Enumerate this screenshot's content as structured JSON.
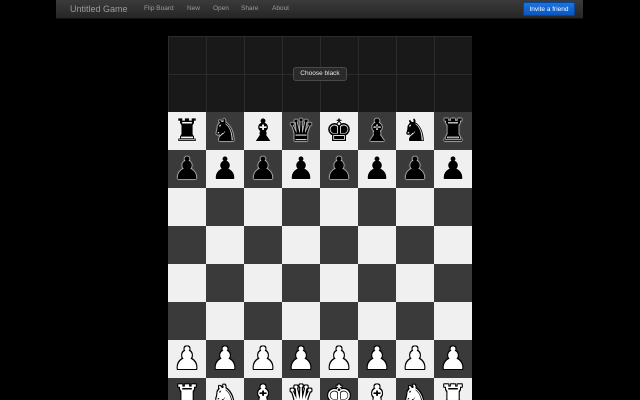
{
  "navbar": {
    "title": "Untitled Game",
    "links": [
      "Flip Board",
      "New",
      "Open",
      "Share",
      "About"
    ],
    "invite_label": "Invite a friend"
  },
  "seat": {
    "choose_label": "Choose black"
  },
  "colors": {
    "light_square": "#f0f0f0",
    "dark_square": "#3a3a3a",
    "accent": "#1a6fd6",
    "background": "#000000"
  },
  "board": {
    "bottom_left_square": "light",
    "ranks": [
      [
        "r",
        "n",
        "b",
        "q",
        "k",
        "b",
        "n",
        "r"
      ],
      [
        "p",
        "p",
        "p",
        "p",
        "p",
        "p",
        "p",
        "p"
      ],
      [
        "",
        "",
        "",
        "",
        "",
        "",
        "",
        ""
      ],
      [
        "",
        "",
        "",
        "",
        "",
        "",
        "",
        ""
      ],
      [
        "",
        "",
        "",
        "",
        "",
        "",
        "",
        ""
      ],
      [
        "",
        "",
        "",
        "",
        "",
        "",
        "",
        ""
      ],
      [
        "P",
        "P",
        "P",
        "P",
        "P",
        "P",
        "P",
        "P"
      ],
      [
        "R",
        "N",
        "B",
        "Q",
        "K",
        "B",
        "N",
        "R"
      ]
    ]
  }
}
